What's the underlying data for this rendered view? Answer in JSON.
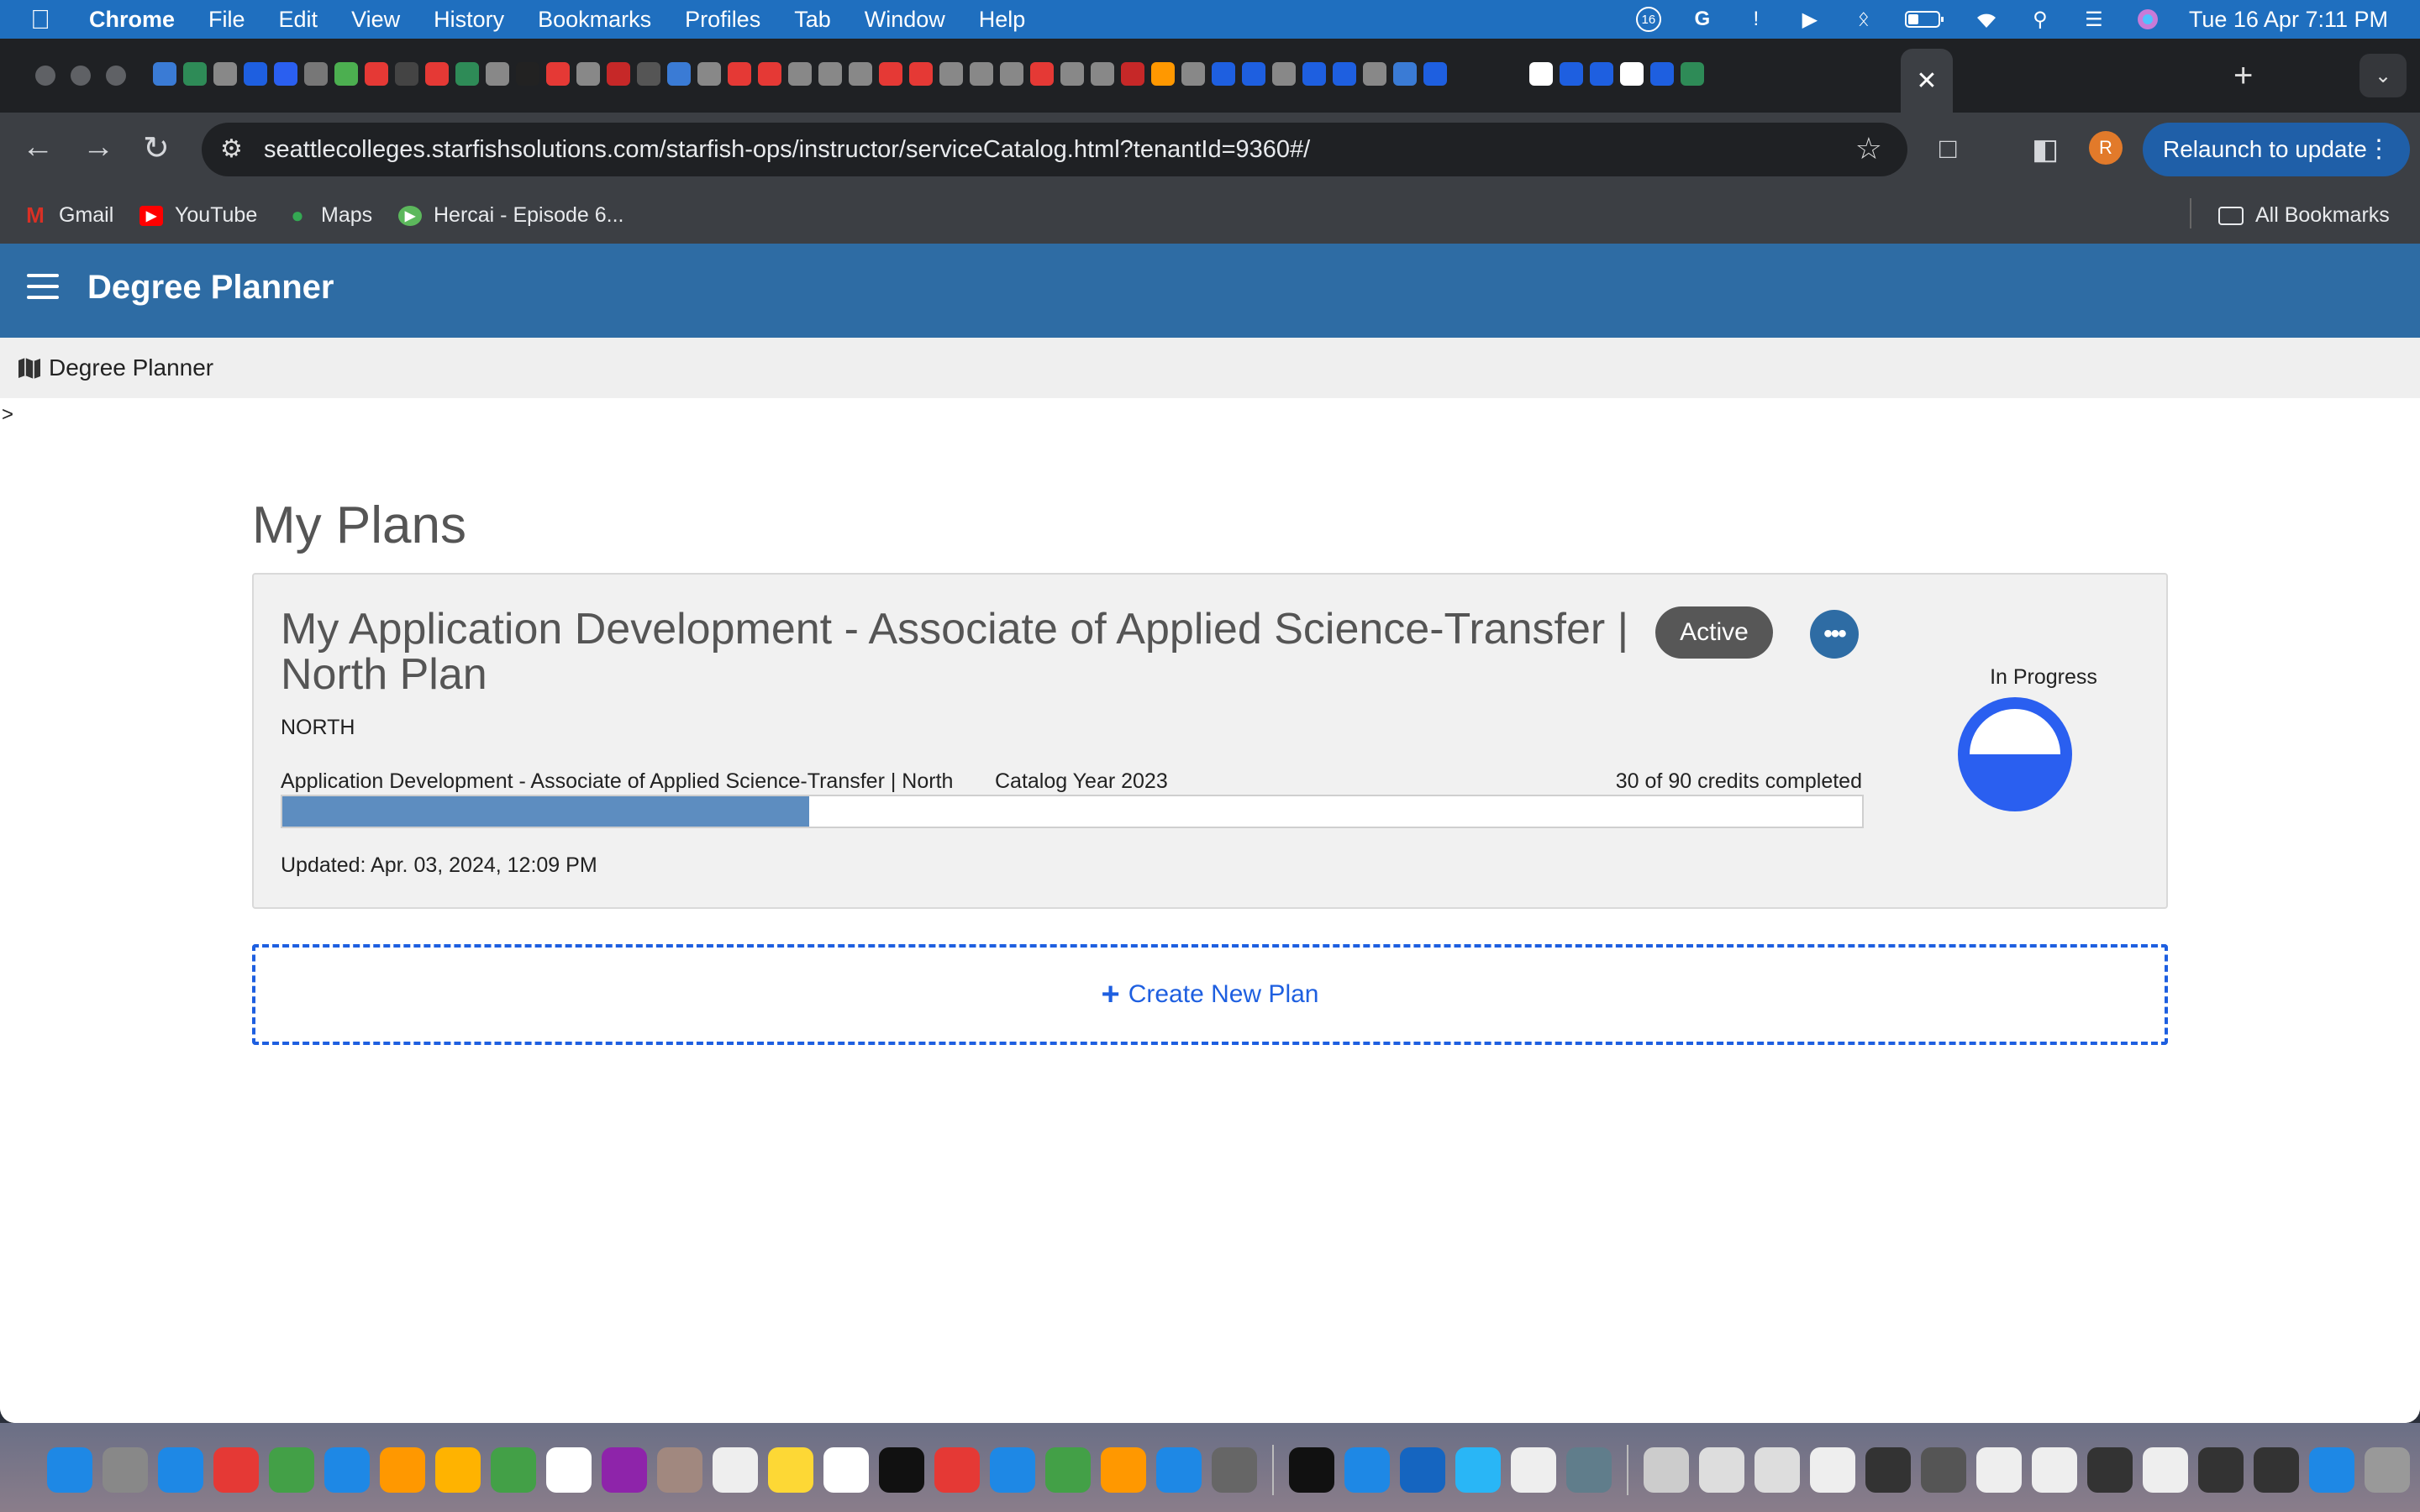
{
  "menubar": {
    "app": "Chrome",
    "items": [
      "File",
      "Edit",
      "View",
      "History",
      "Bookmarks",
      "Profiles",
      "Tab",
      "Window",
      "Help"
    ],
    "clock": "Tue 16 Apr  7:11 PM",
    "badge_count": "16"
  },
  "browser": {
    "url": "seattlecolleges.starfishsolutions.com/starfish-ops/instructor/serviceCatalog.html?tenantId=9360#/",
    "relaunch_label": "Relaunch to update",
    "profile_initial": "R",
    "bookmarks": [
      {
        "label": "Gmail",
        "icon": "gmail-icon",
        "color": "#d93025"
      },
      {
        "label": "YouTube",
        "icon": "youtube-icon",
        "color": "#ff0000"
      },
      {
        "label": "Maps",
        "icon": "maps-icon",
        "color": "#34a853"
      },
      {
        "label": "Hercai - Episode 6...",
        "icon": "play-icon",
        "color": "#5cb85c"
      }
    ],
    "all_bookmarks": "All Bookmarks"
  },
  "app": {
    "title": "Degree Planner",
    "breadcrumb": "Degree Planner",
    "caret": ">"
  },
  "plans": {
    "heading": "My Plans",
    "items": [
      {
        "name": "My Application Development - Associate of Applied Science-Transfer | North Plan",
        "status_badge": "Active",
        "campus": "NORTH",
        "program": "Application Development - Associate of Applied Science-Transfer | North",
        "catalog_year": "Catalog Year 2023",
        "credits_text": "30 of 90 credits completed",
        "credits_completed": 30,
        "credits_total": 90,
        "updated": "Updated: Apr. 03, 2024, 12:09 PM",
        "progress_label": "In Progress"
      }
    ],
    "create_label": "Create New Plan"
  },
  "colors": {
    "app_bar": "#2e6ca4",
    "progress_fill": "#5d8dc0",
    "pie_fill": "#2a5ff0",
    "link": "#1e5fe0"
  }
}
